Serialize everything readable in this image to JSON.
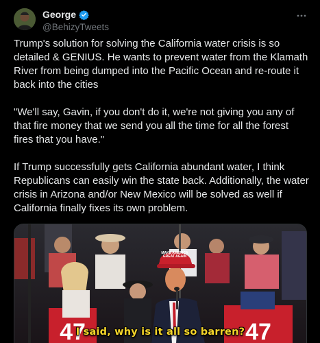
{
  "author": {
    "display_name": "George",
    "handle": "@BehizyTweets",
    "verified": true
  },
  "more_icon": "more-horizontal-icon",
  "tweet": {
    "paragraphs": [
      "Trump's solution for solving the California water crisis is so detailed & GENIUS. He wants to prevent water from the Klamath River from being dumped into the Pacific Ocean and re-route it back into the cities",
      "\"We'll say, Gavin, if you don't do it, we're not giving you any of that fire money that we send you all the time for all the forest fires that you have.\"",
      "If Trump successfully gets California abundant water, I think Republicans can easily win the state back. Additionally, the water crisis in Arizona and/or New Mexico will be solved as well if California finally fixes its own problem."
    ]
  },
  "media": {
    "caption": "I said, why is it all so barren?",
    "hat_text": "MAKE AMERICA GREAT AGAIN",
    "sign_text_left": "47",
    "sign_text_right": "47"
  },
  "colors": {
    "verified": "#1d9bf0",
    "caption": "#f5d52a",
    "background": "#000000"
  }
}
